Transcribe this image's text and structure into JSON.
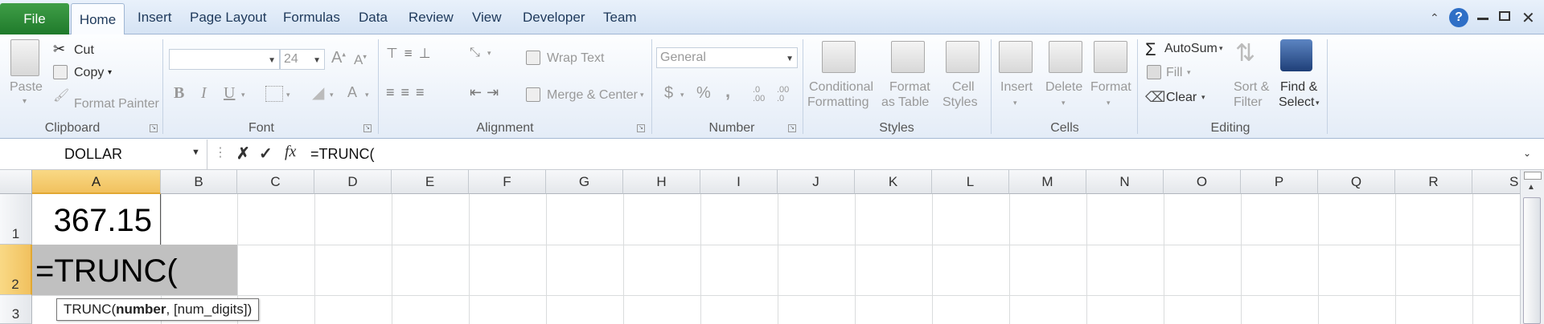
{
  "tabs": {
    "file": "File",
    "home": "Home",
    "insert": "Insert",
    "page_layout": "Page Layout",
    "formulas": "Formulas",
    "data": "Data",
    "review": "Review",
    "view": "View",
    "developer": "Developer",
    "team": "Team"
  },
  "window_icons": [
    "caret-up-icon",
    "help-icon",
    "minimize-icon",
    "restore-icon",
    "close-icon"
  ],
  "ribbon": {
    "clipboard": {
      "paste": "Paste",
      "cut": "Cut",
      "copy": "Copy",
      "format_painter": "Format Painter",
      "label": "Clipboard"
    },
    "font": {
      "font_name": "",
      "font_size": "24",
      "bold": "B",
      "italic": "I",
      "underline": "U",
      "label": "Font"
    },
    "alignment": {
      "wrap_text": "Wrap Text",
      "merge_center": "Merge & Center",
      "label": "Alignment"
    },
    "number": {
      "format": "General",
      "currency": "$",
      "percent": "%",
      "comma": ",",
      "inc_decimal": ".0 .00",
      "dec_decimal": ".00 .0",
      "label": "Number"
    },
    "styles": {
      "conditional_1": "Conditional",
      "conditional_2": "Formatting",
      "format_table_1": "Format",
      "format_table_2": "as Table",
      "cell_styles_1": "Cell",
      "cell_styles_2": "Styles",
      "label": "Styles"
    },
    "cells": {
      "insert": "Insert",
      "delete": "Delete",
      "format": "Format",
      "label": "Cells"
    },
    "editing": {
      "autosum": "AutoSum",
      "fill": "Fill",
      "clear": "Clear",
      "sort_1": "Sort &",
      "sort_2": "Filter",
      "find_1": "Find &",
      "find_2": "Select",
      "label": "Editing"
    }
  },
  "formula_bar": {
    "name_box": "DOLLAR",
    "formula": "=TRUNC("
  },
  "grid": {
    "columns": [
      "A",
      "B",
      "C",
      "D",
      "E",
      "F",
      "G",
      "H",
      "I",
      "J",
      "K",
      "L",
      "M",
      "N",
      "O",
      "P",
      "Q",
      "R",
      "S"
    ],
    "rows": [
      "1",
      "2",
      "3"
    ],
    "a1": "367.15",
    "a2": "=TRUNC(",
    "selected_column": "A",
    "selected_row": "2"
  },
  "tooltip": {
    "prefix": "TRUNC(",
    "arg_bold": "number",
    "rest": ", [num_digits])"
  },
  "colors": {
    "file_tab": "#2a8a36",
    "selection_header": "#f1c15f",
    "edit_cell": "#c0c0c0"
  }
}
